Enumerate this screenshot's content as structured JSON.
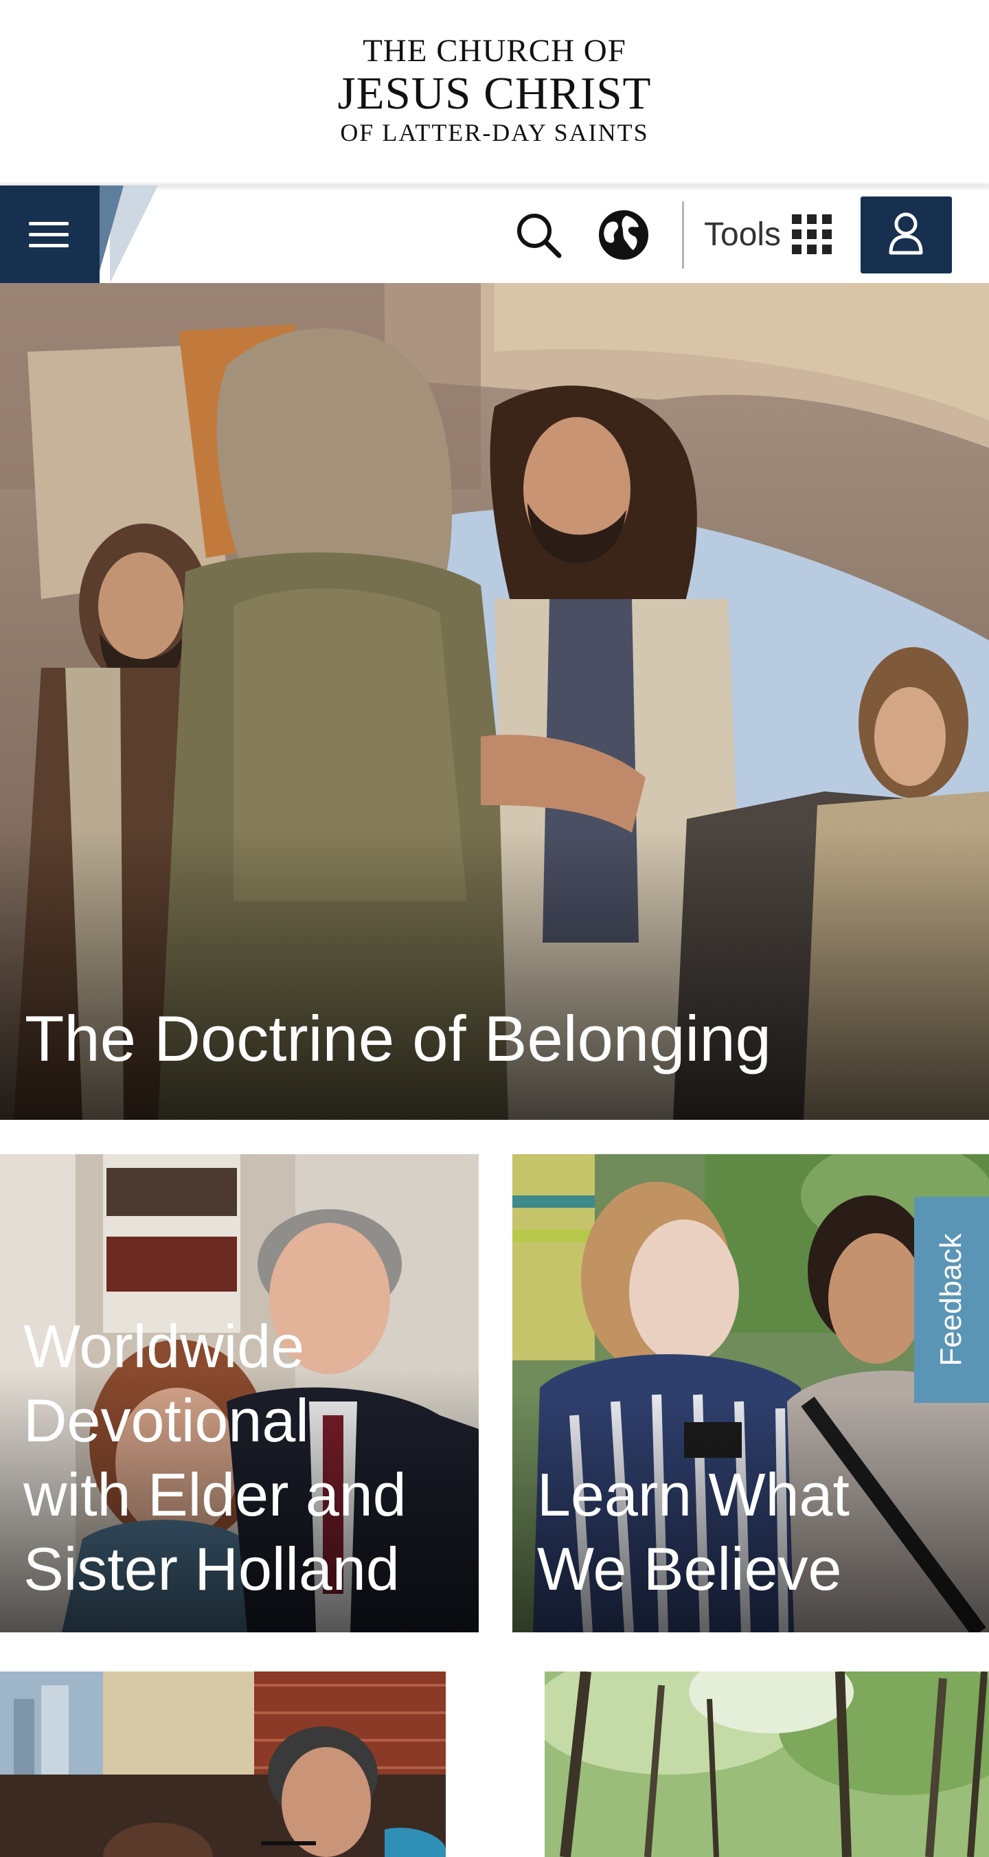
{
  "header": {
    "logo_line1": "THE CHURCH OF",
    "logo_line2": "JESUS CHRIST",
    "logo_line3": "OF LATTER-DAY SAINTS"
  },
  "nav": {
    "menu_icon": "hamburger-menu-icon",
    "search_icon": "search-icon",
    "language_icon": "globe-icon",
    "tools_label": "Tools",
    "tools_icon": "grid-icon",
    "account_icon": "user-icon",
    "brand_color": "#17304f"
  },
  "hero": {
    "title": "The Doctrine of Belonging"
  },
  "cards": [
    {
      "title_lines": [
        "Worldwide",
        "Devotional",
        "with Elder and",
        "Sister Holland"
      ]
    },
    {
      "title_lines": [
        "Learn What",
        "We Believe"
      ]
    },
    {
      "title_lines": []
    },
    {
      "title_lines": []
    }
  ],
  "feedback": {
    "label": "Feedback",
    "color": "#5b95b6"
  }
}
